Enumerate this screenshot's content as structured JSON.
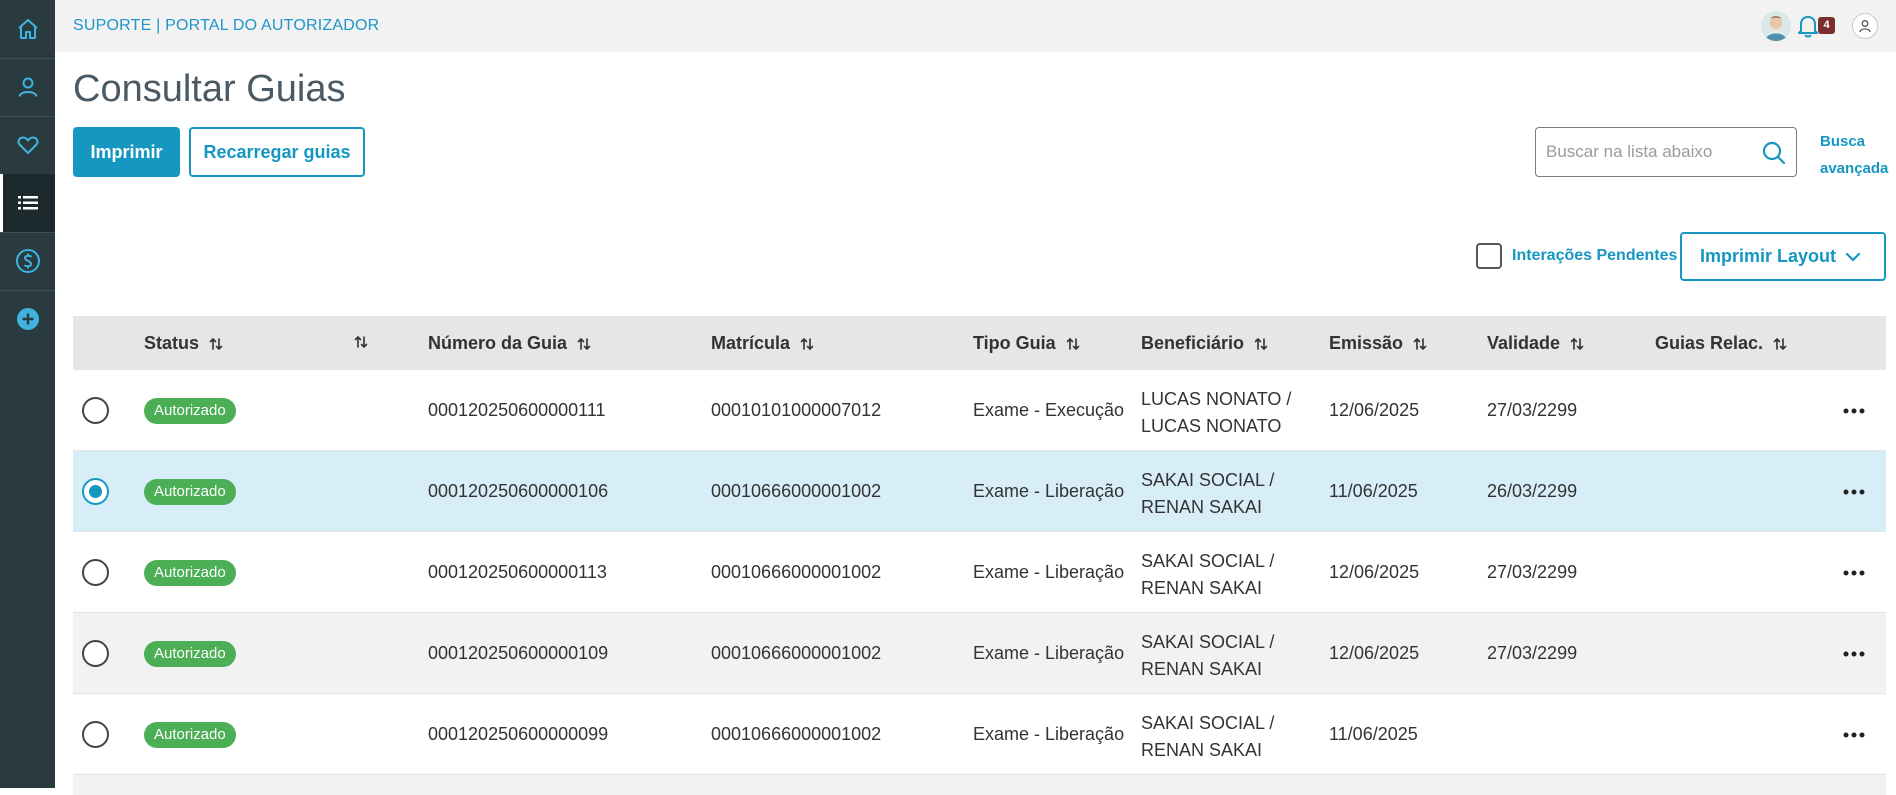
{
  "header": {
    "app_title": "SUPORTE | PORTAL DO AUTORIZADOR",
    "notification_count": "4"
  },
  "sidebar": {
    "items": [
      {
        "icon": "home-icon"
      },
      {
        "icon": "user-icon"
      },
      {
        "icon": "heart-icon"
      },
      {
        "icon": "list-icon",
        "active": true
      },
      {
        "icon": "dollar-icon"
      },
      {
        "icon": "plus-circle-icon"
      }
    ]
  },
  "page": {
    "title": "Consultar Guias",
    "print_label": "Imprimir",
    "reload_label": "Recarregar guias",
    "search_placeholder": "Buscar na lista abaixo",
    "advanced_search_line1": "Busca",
    "advanced_search_line2": "avançada",
    "pending_label": "Interações Pendentes",
    "print_layout_label": "Imprimir Layout"
  },
  "table": {
    "columns": {
      "status": "Status",
      "numero": "Número da Guia",
      "matricula": "Matrícula",
      "tipo": "Tipo Guia",
      "beneficiario": "Beneficiário",
      "emissao": "Emissão",
      "validade": "Validade",
      "relac": "Guias Relac."
    },
    "rows": [
      {
        "selected": false,
        "status": "Autorizado",
        "numero": "000120250600000111",
        "matricula": "00010101000007012",
        "tipo": "Exame - Execução",
        "benef_1": "LUCAS NONATO /",
        "benef_2": "LUCAS NONATO",
        "emissao": "12/06/2025",
        "validade": "27/03/2299",
        "relac": ""
      },
      {
        "selected": true,
        "status": "Autorizado",
        "numero": "000120250600000106",
        "matricula": "00010666000001002",
        "tipo": "Exame - Liberação",
        "benef_1": "SAKAI SOCIAL /",
        "benef_2": "RENAN SAKAI",
        "emissao": "11/06/2025",
        "validade": "26/03/2299",
        "relac": ""
      },
      {
        "selected": false,
        "status": "Autorizado",
        "numero": "000120250600000113",
        "matricula": "00010666000001002",
        "tipo": "Exame - Liberação",
        "benef_1": "SAKAI SOCIAL /",
        "benef_2": "RENAN SAKAI",
        "emissao": "12/06/2025",
        "validade": "27/03/2299",
        "relac": ""
      },
      {
        "selected": false,
        "status": "Autorizado",
        "numero": "000120250600000109",
        "matricula": "00010666000001002",
        "tipo": "Exame - Liberação",
        "benef_1": "SAKAI SOCIAL /",
        "benef_2": "RENAN SAKAI",
        "emissao": "12/06/2025",
        "validade": "27/03/2299",
        "relac": ""
      },
      {
        "selected": false,
        "status": "Autorizado",
        "numero": "000120250600000099",
        "matricula": "00010666000001002",
        "tipo": "Exame - Liberação",
        "benef_1": "SAKAI SOCIAL /",
        "benef_2": "RENAN SAKAI",
        "emissao": "11/06/2025",
        "validade": "",
        "relac": ""
      }
    ]
  },
  "colors": {
    "accent": "#1597c2",
    "sidebar_bg": "#2a3b3f",
    "status_green": "#4cae55",
    "selected_row": "#d7eef9",
    "badge": "#7a2e2e"
  }
}
